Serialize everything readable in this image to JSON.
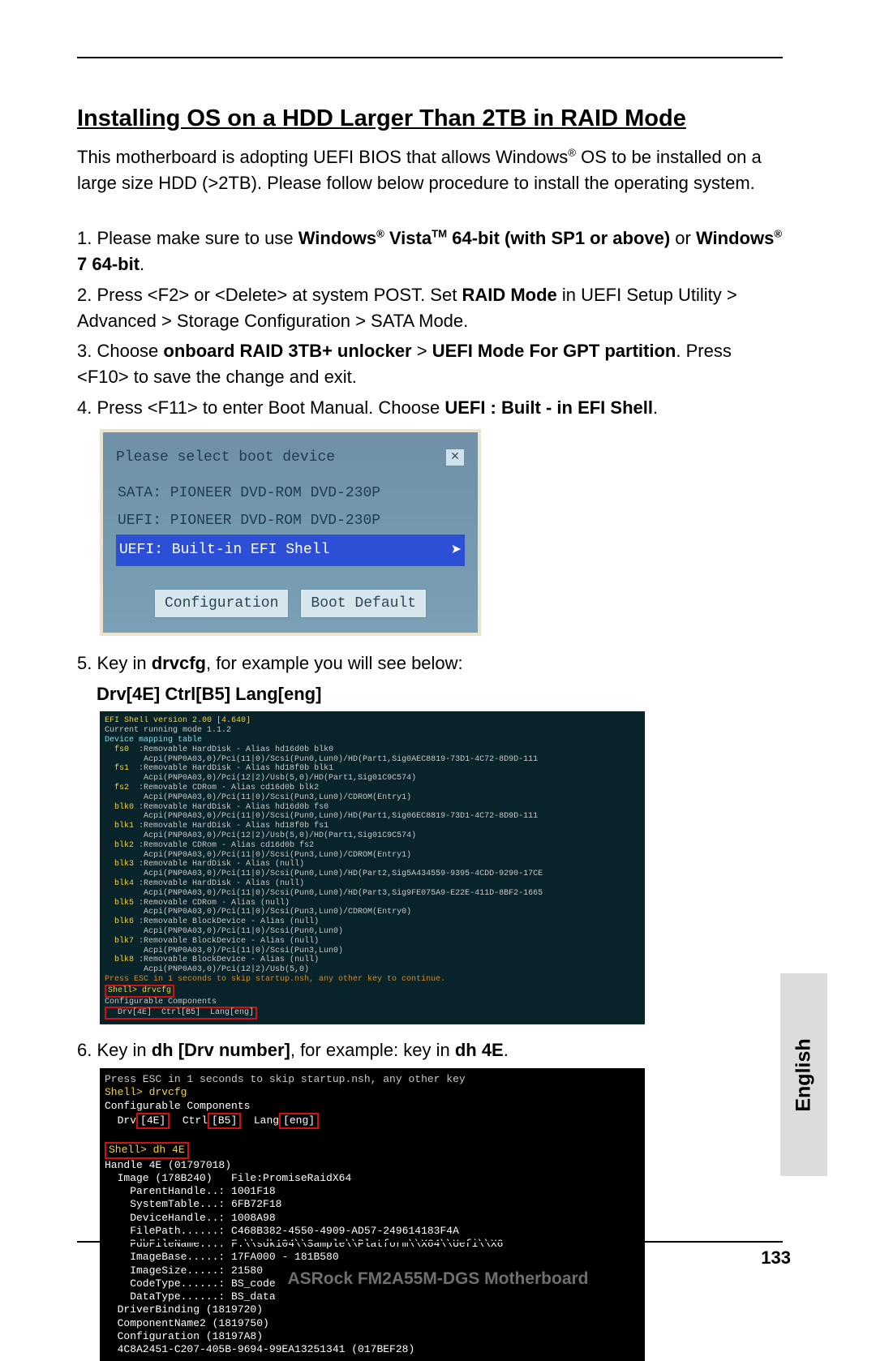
{
  "heading": "Installing OS on a HDD Larger Than 2TB in RAID Mode",
  "intro_html": "This motherboard is adopting UEFI BIOS that allows Windows<sup>®</sup> OS to be installed on a large size HDD (>2TB). Please follow below procedure to install the operating system.",
  "steps": {
    "s1": "1. Please make sure to use <b>Windows<sup>®</sup> Vista<sup>TM</sup> 64-bit (with SP1 or above)</b> or <b>Windows<sup>®</sup> 7 64-bit</b>.",
    "s2": "2. Press <F2> or <Delete> at system POST. Set <b>RAID Mode</b> in UEFI Setup Utility > Advanced > Storage Configuration > SATA Mode.",
    "s3": "3. Choose <b>onboard RAID 3TB+ unlocker</b> > <b>UEFI Mode For GPT partition</b>. Press <F10> to save the change and exit.",
    "s4": "4. Press <F11> to enter Boot Manual. Choose <b>UEFI : Built - in EFI Shell</b>.",
    "s5": "5. Key in <b>drvcfg</b>, for example you will see below:",
    "s5b": "Drv[4E]   Ctrl[B5]   Lang[eng]",
    "s6": "6. Key in <b>dh [Drv number]</b>, for example: key in <b>dh 4E</b>."
  },
  "boot_device": {
    "title": "Please select boot device",
    "close_glyph": "✕",
    "items": [
      "SATA: PIONEER DVD-ROM DVD-230P",
      "UEFI: PIONEER DVD-ROM DVD-230P",
      "UEFI: Built-in EFI Shell"
    ],
    "selected_index": 2,
    "buttons": [
      "Configuration",
      "Boot Default"
    ]
  },
  "drvcfg_shell": {
    "header": "EFI Shell version 2.00 [4.640]",
    "running": "Current running mode 1.1.2",
    "map_title": "Device mapping table",
    "rows": [
      [
        "fs0",
        ":Removable HardDisk - Alias hd16d0b blk0",
        "Acpi(PNP0A03,0)/Pci(11|0)/Scsi(Pun0,Lun0)/HD(Part1,Sig0AEC8819-73D1-4C72-8D9D-111"
      ],
      [
        "fs1",
        ":Removable HardDisk - Alias hd18f0b blk1",
        "Acpi(PNP0A03,0)/Pci(12|2)/Usb(5,0)/HD(Part1,Sig01C9C574)"
      ],
      [
        "fs2",
        ":Removable CDRom - Alias cd16d0b blk2",
        "Acpi(PNP0A03,0)/Pci(11|0)/Scsi(Pun3,Lun0)/CDROM(Entry1)"
      ],
      [
        "blk0",
        ":Removable HardDisk - Alias hd16d0b fs0",
        "Acpi(PNP0A03,0)/Pci(11|0)/Scsi(Pun0,Lun0)/HD(Part1,Sig06EC8819-73D1-4C72-8D9D-111"
      ],
      [
        "blk1",
        ":Removable HardDisk - Alias hd18f0b fs1",
        "Acpi(PNP0A03,0)/Pci(12|2)/Usb(5,0)/HD(Part1,Sig01C9C574)"
      ],
      [
        "blk2",
        ":Removable CDRom - Alias cd16d0b fs2",
        "Acpi(PNP0A03,0)/Pci(11|0)/Scsi(Pun3,Lun0)/CDROM(Entry1)"
      ],
      [
        "blk3",
        ":Removable HardDisk - Alias (null)",
        "Acpi(PNP0A03,0)/Pci(11|0)/Scsi(Pun0,Lun0)/HD(Part2,Sig5A434559-9395-4CDD-9290-17CE"
      ],
      [
        "blk4",
        ":Removable HardDisk - Alias (null)",
        "Acpi(PNP0A03,0)/Pci(11|0)/Scsi(Pun0,Lun0)/HD(Part3,Sig9FE075A9-E22E-411D-8BF2-1665"
      ],
      [
        "blk5",
        ":Removable CDRom - Alias (null)",
        "Acpi(PNP0A03,0)/Pci(11|0)/Scsi(Pun3,Lun0)/CDROM(Entry0)"
      ],
      [
        "blk6",
        ":Removable BlockDevice - Alias (null)",
        "Acpi(PNP0A03,0)/Pci(11|0)/Scsi(Pun0,Lun0)"
      ],
      [
        "blk7",
        ":Removable BlockDevice - Alias (null)",
        "Acpi(PNP0A03,0)/Pci(11|0)/Scsi(Pun3,Lun0)"
      ],
      [
        "blk8",
        ":Removable BlockDevice - Alias (null)",
        "Acpi(PNP0A03,0)/Pci(12|2)/Usb(5,0)"
      ]
    ],
    "press": "Press ESC in 1 seconds to skip startup.nsh, any other key to continue.",
    "shell_prompt": "Shell> drvcfg",
    "conf": "Configurable Components",
    "drv_line": "  Drv[4E]  Ctrl[B5]  Lang[eng]"
  },
  "dh_shell": {
    "line0": "Press ESC in 1 seconds to skip startup.nsh, any other key",
    "prompt1": "Shell> drvcfg",
    "conf": "Configurable Components",
    "drvline": "  Drv[4E]  Ctrl[B5]  Lang[eng]",
    "prompt2": "Shell> dh 4E",
    "handle": "Handle 4E (01797018)",
    "lines": [
      "  Image (178B240)   File:PromiseRaidX64",
      "    ParentHandle..: 1001F18",
      "    SystemTable...: 6FB72F18",
      "    DeviceHandle..: 1008A98",
      "    FilePath......: C468B382-4550-4909-AD57-249614183F4A",
      "    PdbFileName...: F:\\sdk104\\Sample\\Platform\\X64\\Uefi\\X6",
      "    ImageBase.....: 17FA000 - 181B580",
      "    ImageSize.....: 21580",
      "    CodeType......: BS_code",
      "    DataType......: BS_data",
      "  DriverBinding (1819720)",
      "  ComponentName2 (1819750)",
      "  Configuration (18197A8)",
      "  4C8A2451-C207-405B-9694-99EA13251341 (017BEF28)"
    ]
  },
  "side_tab": "English",
  "page_number": "133",
  "footer_brand": "ASRock  FM2A55M-DGS  Motherboard"
}
